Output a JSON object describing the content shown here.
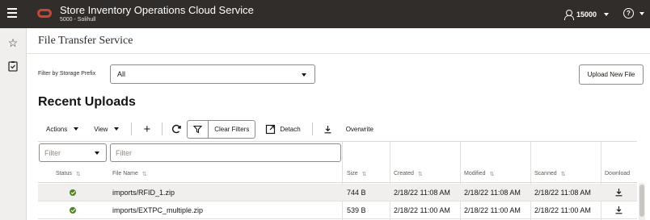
{
  "header": {
    "app_title": "Store Inventory Operations Cloud Service",
    "store": "5000 - Solihull",
    "user": "15000",
    "help_glyph": "?",
    "brand_color": "#c74634"
  },
  "leftnav": {
    "icons": [
      "star-icon",
      "clipboard-check-icon"
    ]
  },
  "page": {
    "title": "File Transfer Service"
  },
  "filter": {
    "label": "Filter by Storage Prefix",
    "value": "All"
  },
  "upload_button": "Upload New File",
  "section_title": "Recent Uploads",
  "toolbar": {
    "actions": "Actions",
    "view": "View",
    "add": "+",
    "clear_filters": "Clear Filters",
    "detach": "Detach",
    "overwrite": "Overwrite"
  },
  "grid_filters": {
    "status_placeholder": "Filter",
    "name_placeholder": "Filter"
  },
  "columns": [
    "Status",
    "File Name",
    "Size",
    "Created",
    "Modified",
    "Scanned",
    "Download"
  ],
  "rows": [
    {
      "status": "success",
      "file": "imports/RFID_1.zip",
      "size": "744 B",
      "created": "2/18/22 11:08 AM",
      "modified": "2/18/22 11:08 AM",
      "scanned": "2/18/22 11:08 AM"
    },
    {
      "status": "success",
      "file": "imports/EXTPC_multiple.zip",
      "size": "539 B",
      "created": "2/18/22 11:00 AM",
      "modified": "2/18/22 11:00 AM",
      "scanned": "2/18/22 11:00 AM"
    }
  ],
  "colors": {
    "topbar": "#312d2a",
    "success": "#508223"
  }
}
